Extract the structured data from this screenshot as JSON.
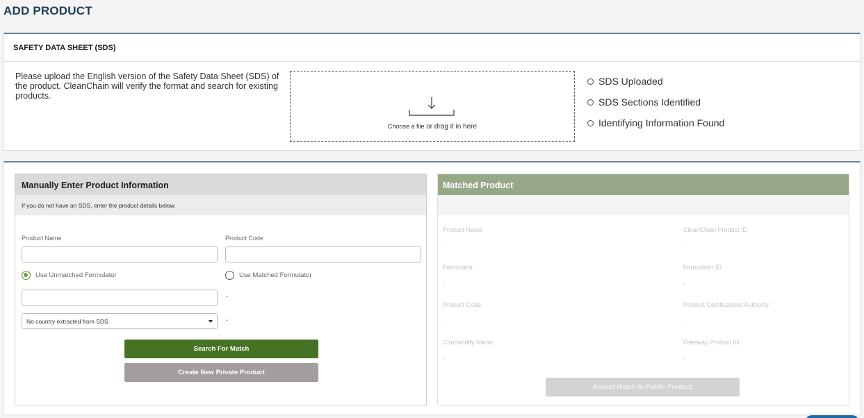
{
  "page": {
    "title": "ADD PRODUCT"
  },
  "sds": {
    "heading": "SAFETY DATA SHEET (SDS)",
    "description": "Please upload the English version of the Safety Data Sheet (SDS) of the product. CleanChain will verify the format and search for existing products.",
    "dropzone": {
      "choose_label": "Choose a file",
      "drag_label": " or drag it in here",
      "icon": "download-arrow-icon"
    },
    "status": [
      {
        "label": "SDS Uploaded"
      },
      {
        "label": "SDS Sections Identified"
      },
      {
        "label": "Identifying Information Found"
      }
    ]
  },
  "manual": {
    "heading": "Manually Enter Product Information",
    "subtext": "If you do not have an SDS, enter the product details below.",
    "product_name_label": "Product Name",
    "product_name_value": "",
    "product_code_label": "Product Code",
    "product_code_value": "",
    "radio_unmatched_label": "Use Unmatched Formulator",
    "radio_unmatched_selected": true,
    "radio_matched_label": "Use Matched Formulator",
    "radio_matched_selected": false,
    "formulator_value": "",
    "formulator_dash": "-",
    "country_selected": "No country extracted from SDS",
    "country_dash": "-",
    "search_button": "Search For Match",
    "create_button": "Create New Private Product"
  },
  "matched": {
    "heading": "Matched Product",
    "fields": [
      {
        "label": "Product Name",
        "value": "-"
      },
      {
        "label": "CleanChain Product ID",
        "value": "-"
      },
      {
        "label": "Formulator",
        "value": "-"
      },
      {
        "label": "Formulator ID",
        "value": "-"
      },
      {
        "label": "Product Code",
        "value": "-"
      },
      {
        "label": "Product Certifications Authority",
        "value": "-"
      },
      {
        "label": "Commodity Name",
        "value": "-"
      },
      {
        "label": "Gateway Product ID",
        "value": "-"
      }
    ],
    "accept_button": "Accept Match to Public Product"
  },
  "colors": {
    "title": "#1f3b57",
    "card_top_border": "#6d8096",
    "primary_green": "#467323",
    "radio_selected": "#6aa33a",
    "matched_header": "#97a888",
    "disabled_button": "#d3d3d3",
    "secondary_button": "#a39d9d"
  }
}
